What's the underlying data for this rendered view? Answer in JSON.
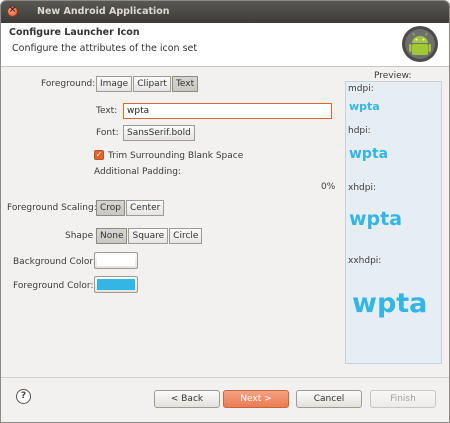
{
  "window": {
    "title": "New Android Application",
    "close_glyph": "×"
  },
  "header": {
    "title": "Configure Launcher Icon",
    "description": "Configure the attributes of the icon set",
    "logo": "android-logo"
  },
  "foreground": {
    "label": "Foreground:",
    "options": [
      "Image",
      "Clipart",
      "Text"
    ],
    "selected": "Text"
  },
  "text": {
    "label": "Text:",
    "value": "wpta"
  },
  "font": {
    "label": "Font:",
    "value": "SansSerif.bold"
  },
  "trim": {
    "label": "Trim Surrounding Blank Space",
    "checked": true,
    "check_glyph": "✓"
  },
  "padding": {
    "label": "Additional Padding:",
    "value": "0%"
  },
  "scaling": {
    "label": "Foreground Scaling:",
    "options": [
      "Crop",
      "Center"
    ],
    "selected": "Crop"
  },
  "shape": {
    "label": "Shape",
    "options": [
      "None",
      "Square",
      "Circle"
    ],
    "selected": "None"
  },
  "background_color": {
    "label": "Background Color:",
    "value": "#ffffff"
  },
  "foreground_color": {
    "label": "Foreground Color:",
    "value": "#33b5e5"
  },
  "preview": {
    "label": "Preview:",
    "sizes": [
      {
        "label": "mdpi:",
        "text": "wpta"
      },
      {
        "label": "hdpi:",
        "text": "wpta"
      },
      {
        "label": "xhdpi:",
        "text": "wpta"
      },
      {
        "label": "xxhdpi:",
        "text": "wpta"
      }
    ]
  },
  "footer": {
    "help_glyph": "?",
    "back": "< Back",
    "next": "Next >",
    "cancel": "Cancel",
    "finish": "Finish"
  }
}
